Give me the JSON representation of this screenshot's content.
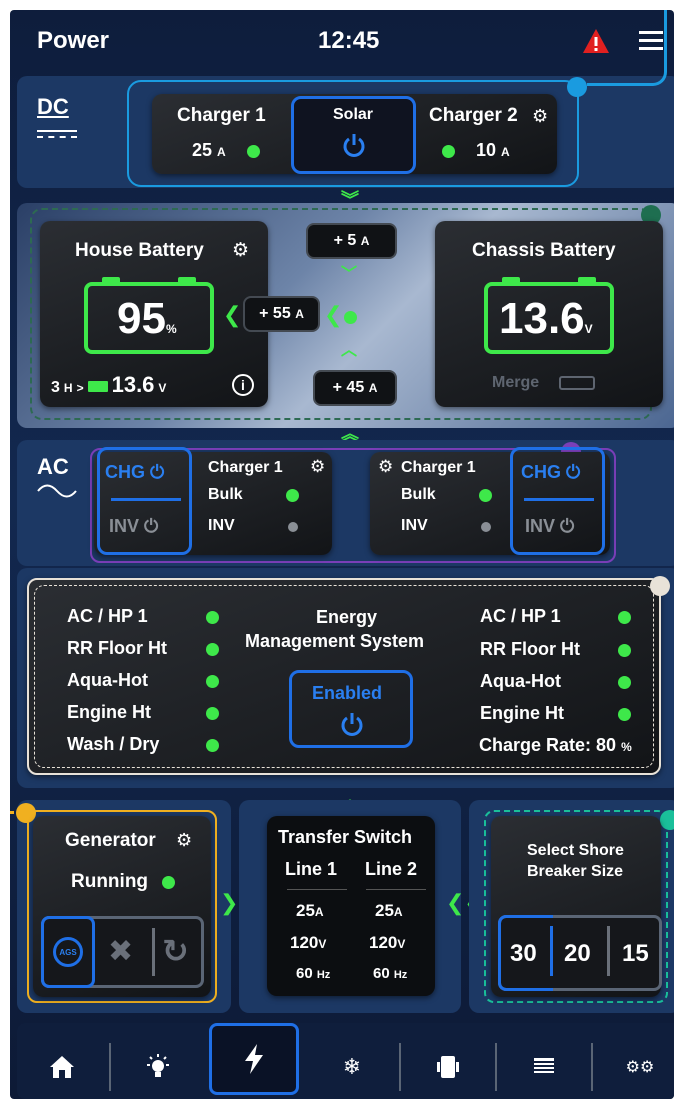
{
  "header": {
    "title": "Power",
    "time": "12:45"
  },
  "dc": {
    "section_label": "DC",
    "charger1": {
      "label": "Charger 1",
      "value": "25",
      "unit": "A"
    },
    "solar": {
      "label": "Solar"
    },
    "charger2": {
      "label": "Charger 2",
      "value": "10",
      "unit": "A"
    }
  },
  "batteries": {
    "house": {
      "label": "House Battery",
      "percent": "95",
      "percent_unit": "%",
      "hours": "3",
      "hours_unit": "H",
      "voltage": "13.6",
      "voltage_unit": "V"
    },
    "chassis": {
      "label": "Chassis Battery",
      "voltage": "13.6",
      "voltage_unit": "V",
      "merge_label": "Merge"
    },
    "flow_top": {
      "value": "+ 5",
      "unit": "A"
    },
    "flow_mid": {
      "value": "+ 55",
      "unit": "A"
    },
    "flow_bottom": {
      "value": "+ 45",
      "unit": "A"
    }
  },
  "ac": {
    "section_label": "AC",
    "left": {
      "chg_label": "CHG",
      "inv_label": "INV",
      "charger_label": "Charger 1",
      "mode": "Bulk",
      "inv": "INV"
    },
    "right": {
      "chg_label": "CHG",
      "inv_label": "INV",
      "charger_label": "Charger 1",
      "mode": "Bulk",
      "inv": "INV"
    }
  },
  "ems": {
    "title_line1": "Energy",
    "title_line2": "Management System",
    "enabled_label": "Enabled",
    "left_items": [
      "AC / HP 1",
      "RR Floor Ht",
      "Aqua-Hot",
      "Engine Ht",
      "Wash / Dry"
    ],
    "right_items": [
      "AC / HP 1",
      "RR Floor Ht",
      "Aqua-Hot",
      "Engine Ht"
    ],
    "charge_rate_label": "Charge Rate:",
    "charge_rate_value": "80",
    "charge_rate_unit": "%"
  },
  "generator": {
    "label": "Generator",
    "status": "Running",
    "ags_label": "AGS"
  },
  "transfer": {
    "title": "Transfer Switch",
    "line1": {
      "label": "Line 1",
      "current": "25",
      "current_unit": "A",
      "voltage": "120",
      "voltage_unit": "V",
      "freq": "60",
      "freq_unit": "Hz"
    },
    "line2": {
      "label": "Line 2",
      "current": "25",
      "current_unit": "A",
      "voltage": "120",
      "voltage_unit": "V",
      "freq": "60",
      "freq_unit": "Hz"
    }
  },
  "shore": {
    "title_line1": "Select Shore",
    "title_line2": "Breaker Size",
    "options": [
      "30",
      "20",
      "15"
    ]
  },
  "nav": {
    "items": [
      "home-icon",
      "light-icon",
      "power-icon",
      "snowflake-icon",
      "slide-icon",
      "shade-icon",
      "settings-icon"
    ]
  },
  "colors": {
    "accent_green": "#3ee84a",
    "accent_blue": "#1f6fe6",
    "alert_red": "#e02020",
    "callout_blue": "#1a9be0",
    "callout_green": "#1e6e50",
    "callout_purple": "#7a3fb8",
    "callout_gold": "#f0b020",
    "callout_teal": "#1abf9a",
    "callout_white": "#e8e2d8"
  }
}
